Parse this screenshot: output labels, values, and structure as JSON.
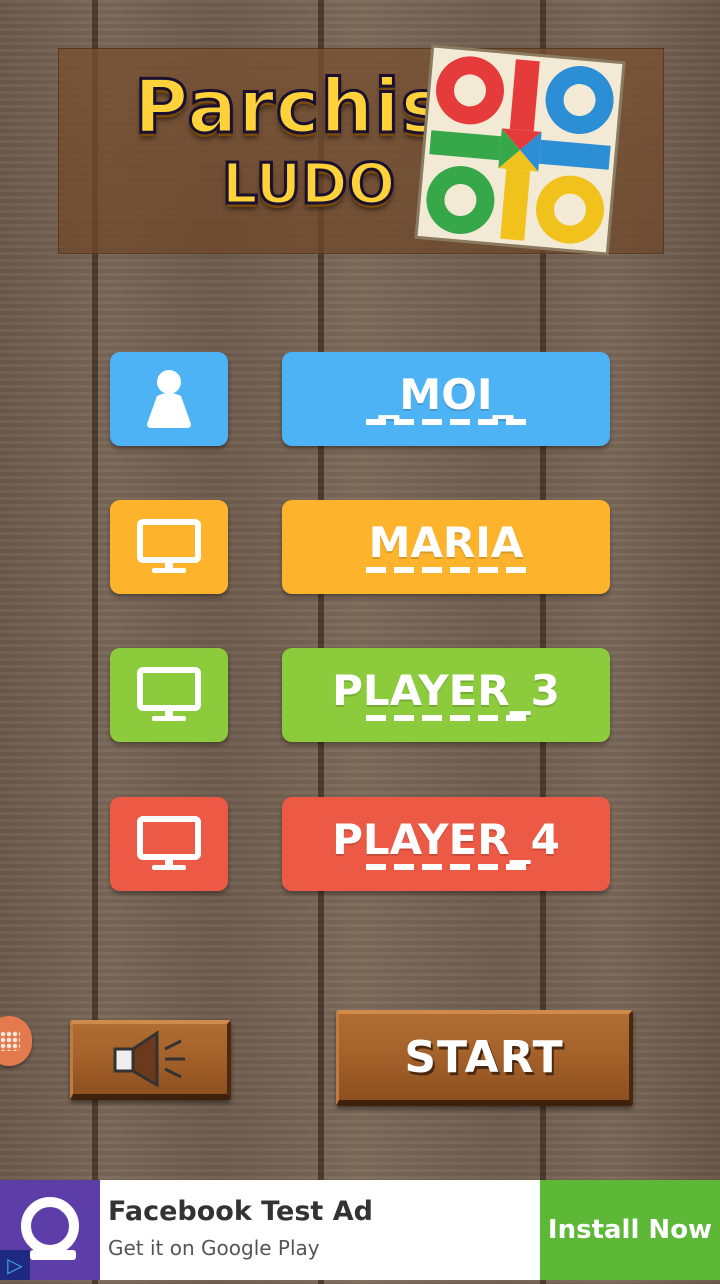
{
  "logo": {
    "line1": "Parchis",
    "line2": "LUDO"
  },
  "players": [
    {
      "name": "_MOI_",
      "type_icon": "pawn-icon",
      "color": "#4db3f5"
    },
    {
      "name": "MARIA",
      "type_icon": "monitor-icon",
      "color": "#fdb32b"
    },
    {
      "name": "PLAYER_3",
      "type_icon": "monitor-icon",
      "color": "#8ccb3c"
    },
    {
      "name": "PLAYER_4",
      "type_icon": "monitor-icon",
      "color": "#ec5945"
    }
  ],
  "controls": {
    "sound_icon": "speaker-icon",
    "start_label": "START"
  },
  "ad": {
    "title": "Facebook Test Ad",
    "subtitle": "Get it on Google Play",
    "cta": "Install Now",
    "badge_icon": "ad-choices-icon"
  },
  "colors": {
    "wood": "#a5622a",
    "ad_purple": "#5d3ea8",
    "install_green": "#5cb836"
  }
}
